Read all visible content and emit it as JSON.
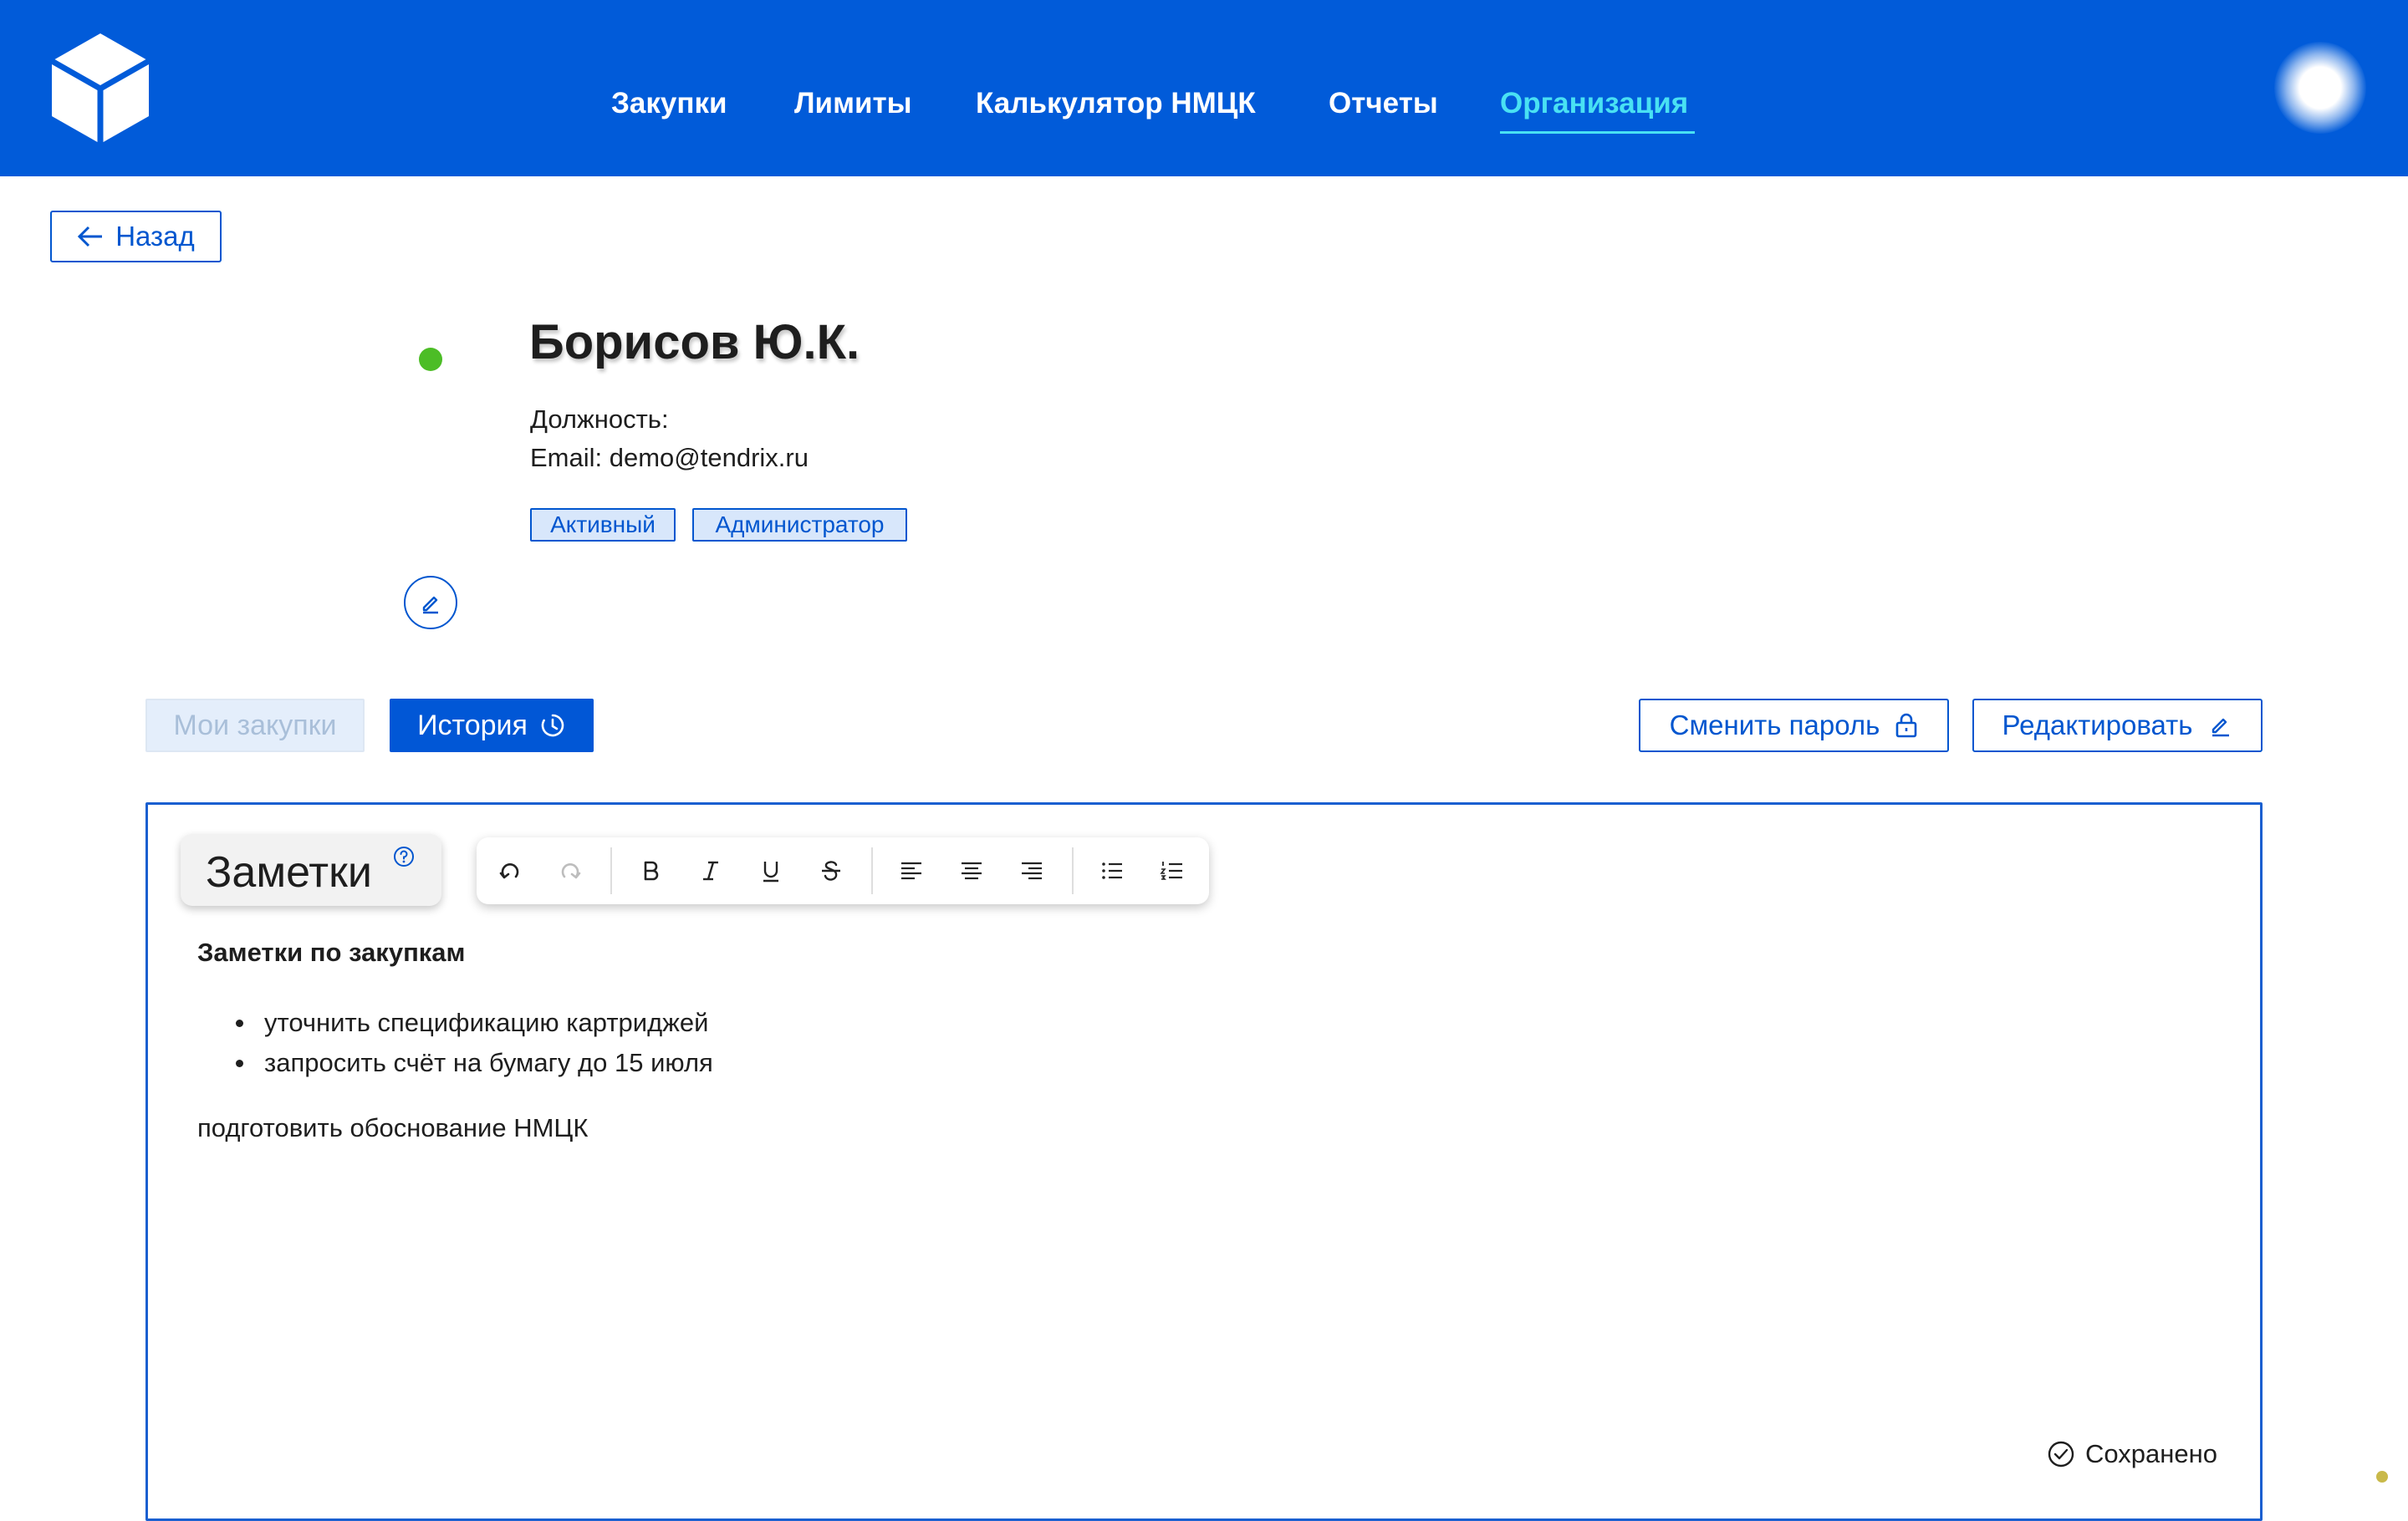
{
  "header": {
    "nav": [
      {
        "label": "Закупки"
      },
      {
        "label": "Лимиты"
      },
      {
        "label": "Калькулятор НМЦК"
      },
      {
        "label": "Отчеты"
      },
      {
        "label": "Организация"
      }
    ],
    "active_nav": "Организация",
    "brand_color": "#015bd9",
    "accent_color": "#49e1f3"
  },
  "back_button": {
    "label": "Назад"
  },
  "profile": {
    "name": "Борисов Ю.К.",
    "position_line": "Должность:",
    "email_line": "Email: demo@tendrix.ru",
    "status_color": "#4cbd26",
    "badges": [
      "Активный",
      "Администратор"
    ]
  },
  "tabs": {
    "my_purchases": "Мои закупки",
    "history": "История"
  },
  "actions": {
    "change_password": "Сменить пароль",
    "edit": "Редактировать"
  },
  "notes": {
    "title": "Заметки",
    "heading": "Заметки по закупкам",
    "items": [
      "уточнить спецификацию картриджей",
      "запросить счёт на бумагу до 15 июля"
    ],
    "paragraph": "подготовить обоснование НМЦК",
    "saved_status": "Сохранено"
  },
  "toolbar_icons": [
    "undo-icon",
    "redo-icon",
    "bold-icon",
    "italic-icon",
    "underline-icon",
    "strikethrough-icon",
    "align-left-icon",
    "align-center-icon",
    "align-right-icon",
    "bullet-list-icon",
    "numbered-list-icon"
  ]
}
